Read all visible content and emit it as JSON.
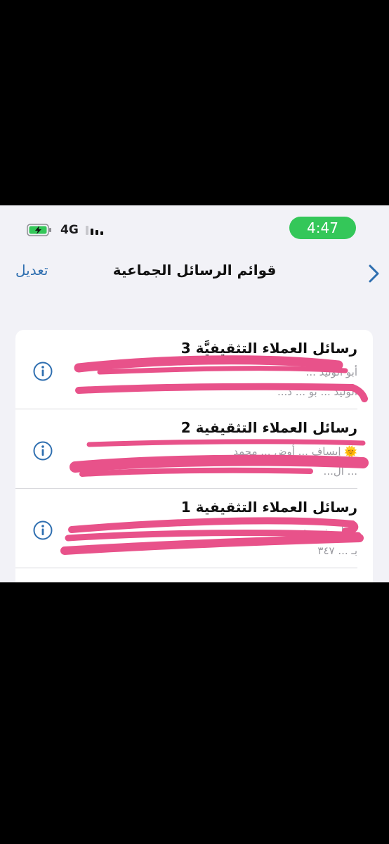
{
  "status_bar": {
    "network": "4G",
    "time": "4:47",
    "battery_icon": "battery-charging-icon",
    "signal_icon": "signal-bars-icon",
    "time_pill_color": "#34c759"
  },
  "nav": {
    "edit_label": "تعديل",
    "title": "قوائم الرسائل الجماعية",
    "back_icon": "chevron-right-icon",
    "accent_color": "#2f6fb0"
  },
  "lists": [
    {
      "title": "رسائل العملاء التثقيفيَّة 3",
      "preview_line1": "أبو الوليد ... ",
      "preview_line2": "الوليد ... بو ... د..."
    },
    {
      "title": "رسائل العملاء التثقيفية 2",
      "preview_line1": "🌞 إيساف ... أوض ... محمد",
      "preview_line2": "... ال..."
    },
    {
      "title": "رسائل العملاء التثقيفية 1",
      "preview_line1": "... أ... ز... ن",
      "preview_line2": "بـ ... ٣٤٧"
    }
  ],
  "redaction_color": "#e8528a"
}
